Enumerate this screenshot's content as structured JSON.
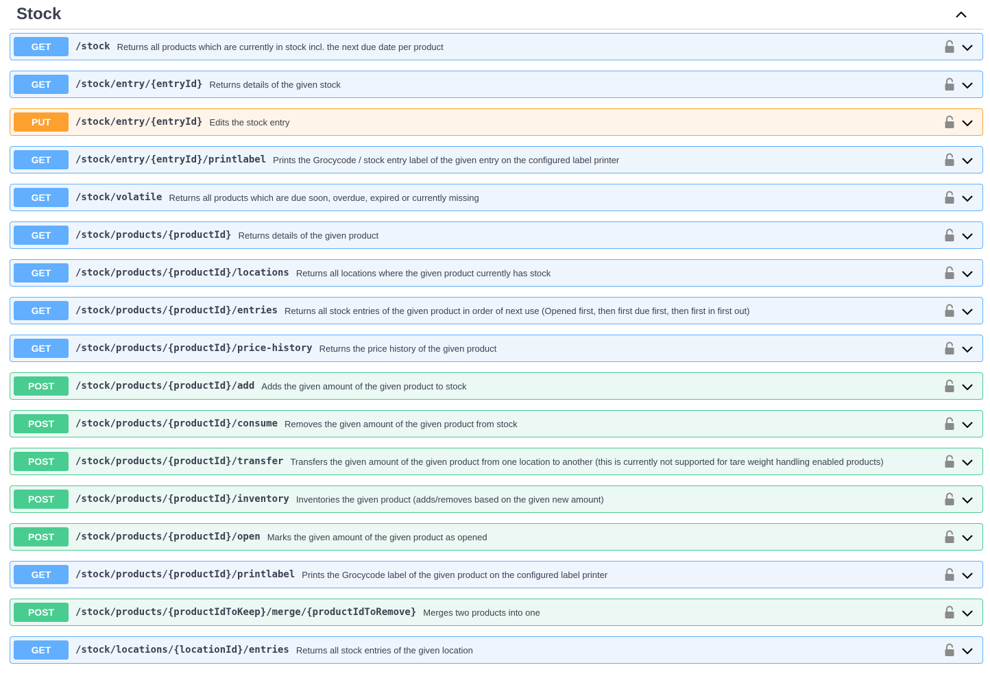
{
  "tag": {
    "title": "Stock",
    "toggle_icon": "chevron-up-icon"
  },
  "colors": {
    "get": "#61affe",
    "put": "#fca130",
    "post": "#49cc90"
  },
  "operations": [
    {
      "method": "GET",
      "path": "/stock",
      "description": "Returns all products which are currently in stock incl. the next due date per product"
    },
    {
      "method": "GET",
      "path": "/stock/entry/{entryId}",
      "description": "Returns details of the given stock"
    },
    {
      "method": "PUT",
      "path": "/stock/entry/{entryId}",
      "description": "Edits the stock entry"
    },
    {
      "method": "GET",
      "path": "/stock/entry/{entryId}/printlabel",
      "description": "Prints the Grocycode / stock entry label of the given entry on the configured label printer"
    },
    {
      "method": "GET",
      "path": "/stock/volatile",
      "description": "Returns all products which are due soon, overdue, expired or currently missing"
    },
    {
      "method": "GET",
      "path": "/stock/products/{productId}",
      "description": "Returns details of the given product"
    },
    {
      "method": "GET",
      "path": "/stock/products/{productId}/locations",
      "description": "Returns all locations where the given product currently has stock"
    },
    {
      "method": "GET",
      "path": "/stock/products/{productId}/entries",
      "description": "Returns all stock entries of the given product in order of next use (Opened first, then first due first, then first in first out)"
    },
    {
      "method": "GET",
      "path": "/stock/products/{productId}/price-history",
      "description": "Returns the price history of the given product"
    },
    {
      "method": "POST",
      "path": "/stock/products/{productId}/add",
      "description": "Adds the given amount of the given product to stock"
    },
    {
      "method": "POST",
      "path": "/stock/products/{productId}/consume",
      "description": "Removes the given amount of the given product from stock"
    },
    {
      "method": "POST",
      "path": "/stock/products/{productId}/transfer",
      "description": "Transfers the given amount of the given product from one location to another (this is currently not supported for tare weight handling enabled products)"
    },
    {
      "method": "POST",
      "path": "/stock/products/{productId}/inventory",
      "description": "Inventories the given product (adds/removes based on the given new amount)"
    },
    {
      "method": "POST",
      "path": "/stock/products/{productId}/open",
      "description": "Marks the given amount of the given product as opened"
    },
    {
      "method": "GET",
      "path": "/stock/products/{productId}/printlabel",
      "description": "Prints the Grocycode label of the given product on the configured label printer"
    },
    {
      "method": "POST",
      "path": "/stock/products/{productIdToKeep}/merge/{productIdToRemove}",
      "description": "Merges two products into one"
    },
    {
      "method": "GET",
      "path": "/stock/locations/{locationId}/entries",
      "description": "Returns all stock entries of the given location"
    }
  ]
}
